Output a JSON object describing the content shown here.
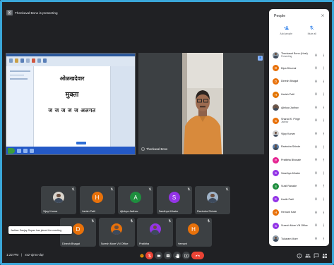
{
  "colors": {
    "frame_border": "#3aa7d9",
    "background": "#202124",
    "tile": "#3c4043",
    "danger": "#ea4335",
    "pin": "#8ab4f8",
    "panel": "#ffffff"
  },
  "top_bar": {
    "icon": "present-icon",
    "text": "Thenkaval Bono is presenting"
  },
  "presentation": {
    "doc_lines": [
      "ओळखदेवार",
      "मुक्ता",
      "ज ज ज ज ज अलगत"
    ]
  },
  "speaker": {
    "name": "Thenkaval Bono",
    "pin_icon": "pin-icon"
  },
  "thumbnails": {
    "row1": [
      {
        "name": "Vijay Kumar",
        "avatar": "photo",
        "color": "#d9d4cc"
      },
      {
        "name": "Harish Patil",
        "avatar": "letter",
        "initial": "H",
        "color": "#e8710a"
      },
      {
        "name": "Ajinkya Jadhav",
        "avatar": "letter",
        "initial": "A",
        "color": "#1e8e3e"
      },
      {
        "name": "Sandhya Mhatre",
        "avatar": "letter",
        "initial": "S",
        "color": "#9334e6"
      },
      {
        "name": "Ravindra Shinde",
        "avatar": "photo",
        "color": "#9fb3c8"
      }
    ],
    "row2": [
      {
        "name": "Dinesh Bhagat",
        "avatar": "letter",
        "initial": "D",
        "color": "#e8710a"
      },
      {
        "name": "Suresh More VN Office",
        "avatar": "photo",
        "color": "#e8710a"
      },
      {
        "name": "Pratibha",
        "avatar": "photo",
        "color": "#9334e6"
      },
      {
        "name": "Hemant",
        "avatar": "letter",
        "initial": "H",
        "color": "#e8710a"
      }
    ]
  },
  "toast": {
    "text": "Jadhav Sanjay Sopan has joined the meeting"
  },
  "bottom_bar": {
    "time": "1:22 PM",
    "separator": "|",
    "meeting": "xvz-ujmo-dqr"
  },
  "controls": [
    {
      "icon": "warning-icon",
      "variant": "warn"
    },
    {
      "icon": "mic-off-icon",
      "variant": "danger"
    },
    {
      "icon": "videocam-icon",
      "variant": "default"
    },
    {
      "icon": "closed-caption-icon",
      "variant": "default"
    },
    {
      "icon": "raise-hand-icon",
      "variant": "default"
    },
    {
      "icon": "present-to-all-icon",
      "variant": "default"
    },
    {
      "icon": "call-end-icon",
      "variant": "end"
    }
  ],
  "side_icons": [
    "info-icon",
    "people-icon",
    "chat-icon",
    "activities-icon"
  ],
  "people_panel": {
    "title": "People",
    "close_icon": "close-icon",
    "actions": [
      {
        "label": "Add people",
        "icon": "person-add-icon"
      },
      {
        "label": "Mute all",
        "icon": "mic-off-icon"
      }
    ],
    "participants": [
      {
        "name": "Thenkaval Bono (Host)",
        "sub": "Presenting",
        "avatar": "photo",
        "color": "#8e9aa4"
      },
      {
        "name": "Dipa Dhumal",
        "avatar": "letter",
        "initial": "D",
        "color": "#e8710a"
      },
      {
        "name": "Dinesh Bhagat",
        "avatar": "letter",
        "initial": "D",
        "color": "#e8710a"
      },
      {
        "name": "Harish Patil",
        "avatar": "letter",
        "initial": "H",
        "color": "#e37400"
      },
      {
        "name": "Ajinkya Jadhav",
        "avatar": "photo",
        "color": "#6d5a4e"
      },
      {
        "name": "Sharad K. Pinge",
        "sub": "Jadhav",
        "avatar": "letter",
        "initial": "S",
        "color": "#e8710a"
      },
      {
        "name": "Vijay Kumar",
        "avatar": "photo",
        "color": "#cfcfcf"
      },
      {
        "name": "Ravindra Shinde",
        "avatar": "photo",
        "color": "#5c7fa8"
      },
      {
        "name": "Pratibha Bhosale",
        "avatar": "letter",
        "initial": "P",
        "color": "#e52592"
      },
      {
        "name": "Sandhya Mhatre",
        "avatar": "letter",
        "initial": "S",
        "color": "#9334e6"
      },
      {
        "name": "Sunil Ranade",
        "avatar": "letter",
        "initial": "S",
        "color": "#1e8e3e"
      },
      {
        "name": "Kartik Patil",
        "avatar": "letter",
        "initial": "K",
        "color": "#9334e6"
      },
      {
        "name": "Hemant Kale",
        "avatar": "letter",
        "initial": "H",
        "color": "#e8710a"
      },
      {
        "name": "Suresh More VN Office",
        "avatar": "letter",
        "initial": "S",
        "color": "#9334e6"
      },
      {
        "name": "Tukaram More",
        "avatar": "photo",
        "color": "#8c9aa6"
      }
    ]
  }
}
